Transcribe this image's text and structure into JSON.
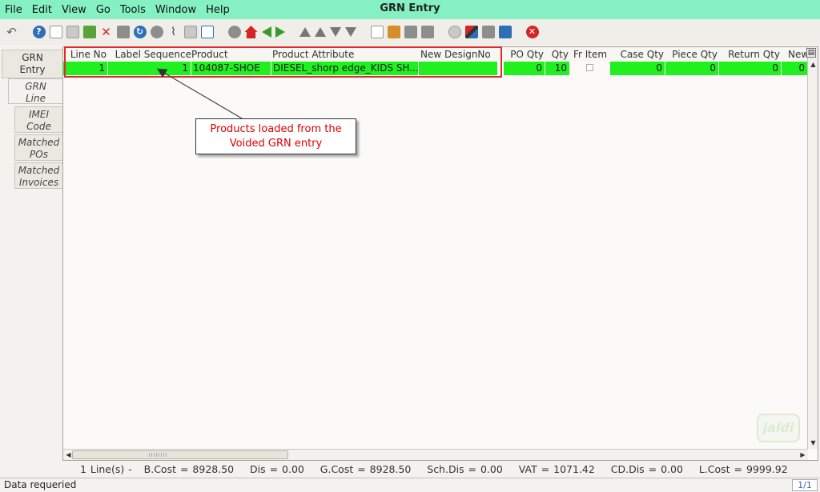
{
  "menu": [
    "File",
    "Edit",
    "View",
    "Go",
    "Tools",
    "Window",
    "Help"
  ],
  "window_title": "GRN Entry",
  "side_tabs": [
    {
      "label_lines": [
        "GRN",
        "Entry"
      ],
      "active": false
    },
    {
      "label_lines": [
        "GRN",
        "Line"
      ],
      "active": true
    },
    {
      "label_lines": [
        "IMEI",
        "Code"
      ],
      "active": false
    },
    {
      "label_lines": [
        "Matched",
        "POs"
      ],
      "active": false
    },
    {
      "label_lines": [
        "Matched",
        "Invoices"
      ],
      "active": false
    }
  ],
  "grid": {
    "columns": [
      "Line No",
      "Label Sequence",
      "Product",
      "Product Attribute",
      "New DesignNo",
      "PO Qty",
      "Qty",
      "Fr Item",
      "Case Qty",
      "Piece Qty",
      "Return Qty",
      "New I"
    ],
    "rows": [
      {
        "line_no": "1",
        "label_sequence": "1",
        "product": "104087-SHOE",
        "product_attribute": "DIESEL_shorp edge_KIDS SH...",
        "new_design_no": "",
        "po_qty": "0",
        "qty": "10",
        "fr_item": false,
        "case_qty": "0",
        "piece_qty": "0",
        "return_qty": "0",
        "new_i": "0"
      }
    ]
  },
  "annotation": {
    "line1": "Products loaded from the",
    "line2": "Voided GRN entry"
  },
  "watermark": "jaldi",
  "summary": {
    "lines": "1 Line(s) -",
    "bcost": "B.Cost = 8928.50",
    "dis": "Dis = 0.00",
    "gcost": "G.Cost = 8928.50",
    "schdis": "Sch.Dis = 0.00",
    "vat": "VAT = 1071.42",
    "cddis": "CD.Dis = 0.00",
    "lcost": "L.Cost = 9999.92"
  },
  "status": {
    "text": "Data requeried",
    "page": "1/1"
  },
  "colors": {
    "title_bar": "#85f0c2",
    "row_highlight": "#20f020",
    "annotation_red": "#e02a2a"
  },
  "toolbar_icons": [
    "undo-icon",
    "help-icon",
    "new-icon",
    "copy-icon",
    "save-icon",
    "delete-icon",
    "print-preview-icon",
    "refresh-icon",
    "find-icon",
    "attachment-icon",
    "chat-icon",
    "zoom-fit-icon",
    "history-icon",
    "home-icon",
    "back-icon",
    "forward-icon",
    "first-record-icon",
    "previous-record-icon",
    "next-record-icon",
    "last-record-icon",
    "report-icon",
    "archive-icon",
    "print-icon",
    "print-alt-icon",
    "zoom-across-icon",
    "workflow-icon",
    "process-icon",
    "product-info-icon",
    "close-icon"
  ]
}
